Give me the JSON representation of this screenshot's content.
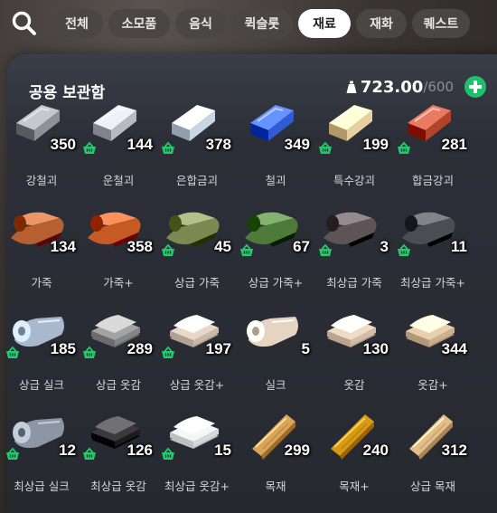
{
  "tabs": [
    "전체",
    "소모품",
    "음식",
    "퀵슬롯",
    "재료",
    "재화",
    "퀘스트"
  ],
  "active_tab": 4,
  "storage": {
    "title": "공용 보관함",
    "current": "723.00",
    "max": "/600"
  },
  "colors": {
    "accent_green": "#1fbf6b",
    "active_tab_bg": "#ffffff"
  },
  "items": [
    {
      "name": "강철괴",
      "qty": "350",
      "icon": "ingot",
      "color": "#8e9196",
      "basket": false
    },
    {
      "name": "운철괴",
      "qty": "144",
      "icon": "ingot",
      "color": "#b7bac0",
      "basket": true
    },
    {
      "name": "은합금괴",
      "qty": "378",
      "icon": "ingot",
      "color": "#c8d6e4",
      "basket": true
    },
    {
      "name": "철괴",
      "qty": "349",
      "icon": "ingot",
      "color": "#2f5cd6",
      "basket": false
    },
    {
      "name": "특수강괴",
      "qty": "199",
      "icon": "ingot",
      "color": "#e9cfa0",
      "basket": true
    },
    {
      "name": "합금강괴",
      "qty": "281",
      "icon": "ingot",
      "color": "#b3442a",
      "basket": true
    },
    {
      "name": "가죽",
      "qty": "134",
      "icon": "leather",
      "color": "#b5602e",
      "basket": false
    },
    {
      "name": "가죽+",
      "qty": "358",
      "icon": "leather",
      "color": "#c65a25",
      "basket": false
    },
    {
      "name": "상급 가죽",
      "qty": "45",
      "icon": "leather",
      "color": "#7c8a52",
      "basket": true
    },
    {
      "name": "상급 가죽+",
      "qty": "67",
      "icon": "leather",
      "color": "#4e7a3a",
      "basket": true
    },
    {
      "name": "최상급 가죽",
      "qty": "3",
      "icon": "leather",
      "color": "#5e5458",
      "basket": true
    },
    {
      "name": "최상급 가죽+",
      "qty": "11",
      "icon": "leather",
      "color": "#4a4d52",
      "basket": true
    },
    {
      "name": "상급 실크",
      "qty": "185",
      "icon": "silk",
      "color": "#a9b8cc",
      "basket": true
    },
    {
      "name": "상급 옷감",
      "qty": "289",
      "icon": "cloth",
      "color": "#a3a3a3",
      "basket": true
    },
    {
      "name": "상급 옷감+",
      "qty": "197",
      "icon": "cloth",
      "color": "#e8d8c8",
      "basket": true
    },
    {
      "name": "실크",
      "qty": "5",
      "icon": "silk",
      "color": "#e6d4c2",
      "basket": false
    },
    {
      "name": "옷감",
      "qty": "130",
      "icon": "cloth",
      "color": "#f0dcc4",
      "basket": false
    },
    {
      "name": "옷감+",
      "qty": "344",
      "icon": "cloth",
      "color": "#e9cfae",
      "basket": false
    },
    {
      "name": "최상급 실크",
      "qty": "12",
      "icon": "silk",
      "color": "#8c96a4",
      "basket": true
    },
    {
      "name": "최상급 옷감",
      "qty": "126",
      "icon": "cloth",
      "color": "#3a3a3c",
      "basket": true
    },
    {
      "name": "최상급 옷감+",
      "qty": "15",
      "icon": "cloth",
      "color": "#f4f6f8",
      "basket": true
    },
    {
      "name": "목재",
      "qty": "299",
      "icon": "plank",
      "color": "#d9a45a",
      "basket": false
    },
    {
      "name": "목재+",
      "qty": "240",
      "icon": "plank",
      "color": "#d49a18",
      "basket": false
    },
    {
      "name": "상급 목재",
      "qty": "312",
      "icon": "plank",
      "color": "#e2bd8a",
      "basket": false
    }
  ]
}
